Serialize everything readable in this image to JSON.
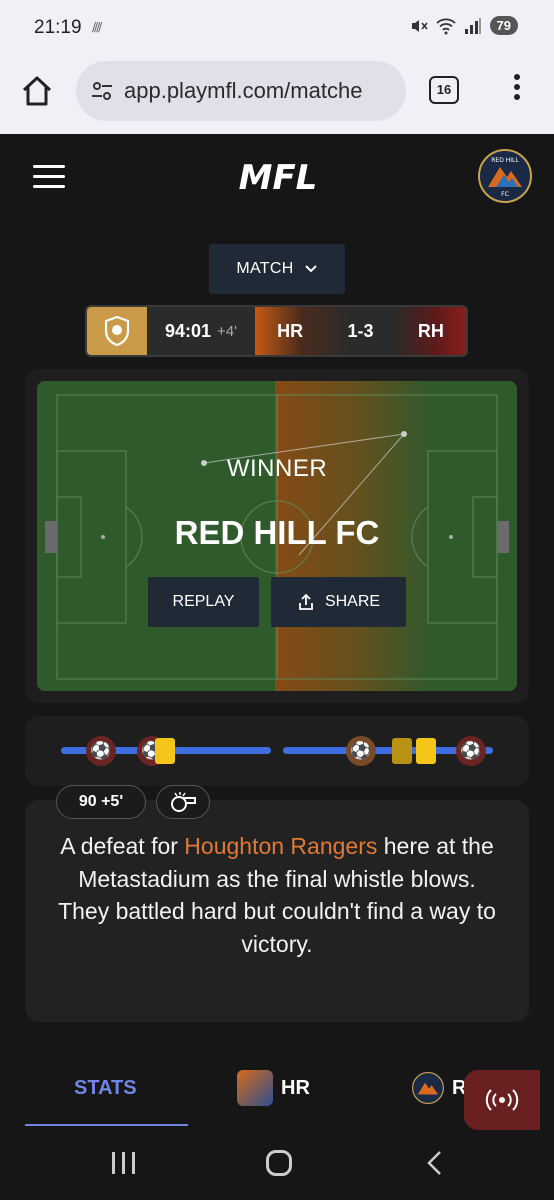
{
  "status_bar": {
    "time": "21:19",
    "notif_glyph": "////",
    "battery": "79"
  },
  "browser": {
    "url": "app.playmfl.com/matche",
    "tab_count": "16"
  },
  "app": {
    "logo_text": "MFL"
  },
  "match_dropdown": {
    "label": "MATCH"
  },
  "scoreboard": {
    "time": "94:01",
    "added_time": "+4'",
    "home": "HR",
    "score": "1-3",
    "away": "RH"
  },
  "result": {
    "label": "WINNER",
    "team": "RED HILL FC",
    "replay": "REPLAY",
    "share": "SHARE"
  },
  "timeline": {
    "events": [
      "goal-icon",
      "goal-icon",
      "yellow-card-icon",
      "goal-icon",
      "yellow-card-icon",
      "yellow-card-icon",
      "goal-icon"
    ]
  },
  "commentary": {
    "minute": "90 +5'",
    "text_before": "A defeat for ",
    "team": "Houghton Rangers",
    "text_after": " here at the Metastadium as the final whistle blows.",
    "line2": "They battled hard but couldn't find a way to victory."
  },
  "tabs": {
    "stats": "STATS",
    "home": "HR",
    "away": "R"
  },
  "colors": {
    "accent_blue": "#6f86e8",
    "team_orange": "#e07a35",
    "away_red": "#8b1d1d",
    "league_gold": "#c99a48"
  }
}
